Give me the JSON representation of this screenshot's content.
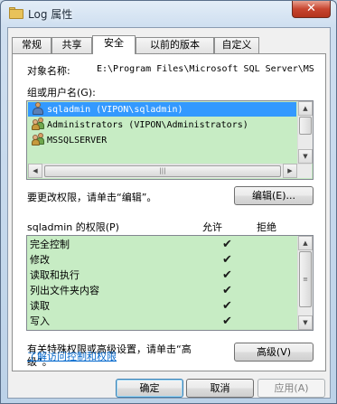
{
  "window": {
    "title": "Log 属性",
    "close_label": "✕"
  },
  "tabs": [
    {
      "label": "常规"
    },
    {
      "label": "共享"
    },
    {
      "label": "安全"
    },
    {
      "label": "以前的版本"
    },
    {
      "label": "自定义"
    }
  ],
  "security": {
    "object_name_label": "对象名称:",
    "object_name_value": "E:\\Program Files\\Microsoft SQL Server\\MS",
    "group_label": "组或用户名(G):",
    "principals": [
      {
        "name": "sqladmin (VIPON\\sqladmin)",
        "icon": "user-icon",
        "selected": true
      },
      {
        "name": "Administrators (VIPON\\Administrators)",
        "icon": "group-icon",
        "selected": false
      },
      {
        "name": "MSSQLSERVER",
        "icon": "group-icon",
        "selected": false
      }
    ],
    "change_hint": "要更改权限，请单击“编辑”。",
    "edit_button": "编辑(E)...",
    "perm_header": "sqladmin 的权限(P)",
    "allow_col": "允许",
    "deny_col": "拒绝",
    "permissions": [
      {
        "name": "完全控制",
        "allow": "✔"
      },
      {
        "name": "修改",
        "allow": "✔"
      },
      {
        "name": "读取和执行",
        "allow": "✔"
      },
      {
        "name": "列出文件夹内容",
        "allow": "✔"
      },
      {
        "name": "读取",
        "allow": "✔"
      },
      {
        "name": "写入",
        "allow": "✔"
      }
    ],
    "advanced_hint_line1": "有关特殊权限或高级设置，请单击“高",
    "advanced_hint_line2": "级”。",
    "advanced_button": "高级(V)",
    "learn_link": "了解访问控制和权限"
  },
  "footer": {
    "ok": "确定",
    "cancel": "取消",
    "apply": "应用(A)"
  },
  "colors": {
    "permission_highlight": "#c7ecc4",
    "selection": "#3399ff",
    "link": "#0066cc"
  }
}
